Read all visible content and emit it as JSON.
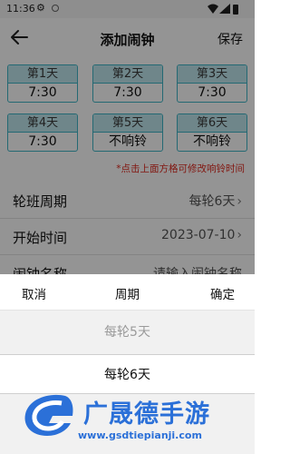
{
  "status_bar": {
    "time": "11:36"
  },
  "header": {
    "title": "添加闹钟",
    "save_label": "保存"
  },
  "days": [
    {
      "label": "第1天",
      "value": "7:30"
    },
    {
      "label": "第2天",
      "value": "7:30"
    },
    {
      "label": "第3天",
      "value": "7:30"
    },
    {
      "label": "第4天",
      "value": "7:30"
    },
    {
      "label": "第5天",
      "value": "不响铃"
    },
    {
      "label": "第6天",
      "value": "不响铃"
    }
  ],
  "hint": "*点击上面方格可修改响铃时间",
  "rows": {
    "cycle": {
      "label": "轮班周期",
      "value": "每轮6天"
    },
    "start": {
      "label": "开始时间",
      "value": "2023-07-10"
    },
    "name": {
      "label": "闹钟名称",
      "placeholder": "请输入闹钟名称"
    }
  },
  "picker": {
    "cancel_label": "取消",
    "title": "周期",
    "confirm_label": "确定",
    "options": [
      "每轮5天",
      "每轮6天"
    ],
    "selected": "每轮6天"
  },
  "watermark": {
    "brand": "广晟德手游",
    "url": "www.gsdtiepianji.com"
  },
  "colors": {
    "accent": "#3fb6c6",
    "hint_red": "#e0281e",
    "watermark_blue": "#2b70d8"
  }
}
